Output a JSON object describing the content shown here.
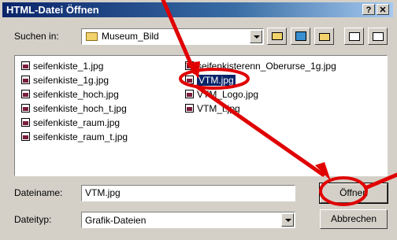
{
  "window": {
    "title": "HTML-Datei Öffnen",
    "help_label": "?",
    "close_label": "✕"
  },
  "lookin": {
    "label": "Suchen in:",
    "value": "Museum_Bild"
  },
  "files_col1": [
    "seifenkiste_1.jpg",
    "seifenkiste_1g.jpg",
    "seifenkiste_hoch.jpg",
    "seifenkiste_hoch_t.jpg",
    "seifenkiste_raum.jpg",
    "seifenkiste_raum_t.jpg"
  ],
  "files_col2": [
    "seifenkisterenn_Oberurse_1g.jpg",
    "VTM.jpg",
    "VTM_Logo.jpg",
    "VTM_t.jpg"
  ],
  "filename": {
    "label": "Dateiname:",
    "value": "VTM.jpg"
  },
  "filetype": {
    "label": "Dateityp:",
    "value": "Grafik-Dateien"
  },
  "buttons": {
    "open": "Öffnen",
    "cancel": "Abbrechen"
  },
  "annotation_color": "#e00000"
}
